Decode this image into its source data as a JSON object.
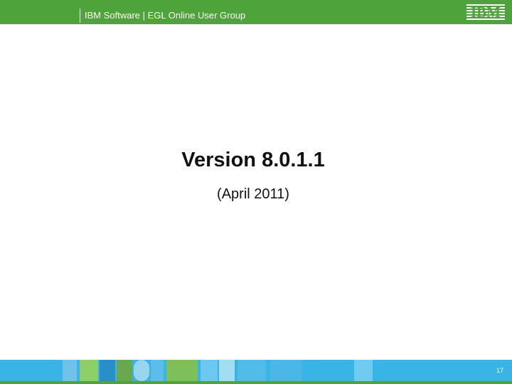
{
  "header": {
    "title": "IBM Software | EGL Online User Group",
    "logo": "IBM"
  },
  "slide": {
    "title": "Version 8.0.1.1",
    "subtitle": "(April 2011)"
  },
  "footer": {
    "page_number": "17"
  },
  "colors": {
    "header_green": "#4FA33B",
    "footer_blue": "#39B4E5"
  }
}
